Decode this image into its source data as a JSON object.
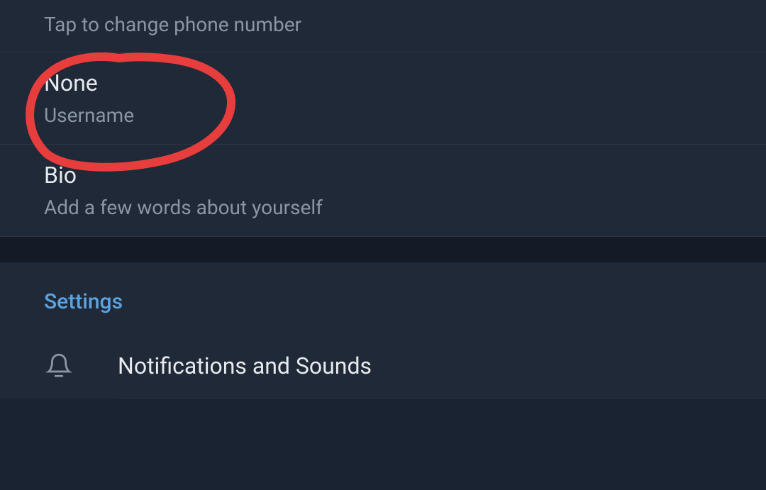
{
  "account": {
    "phone_hint": "Tap to change phone number",
    "username_value": "None",
    "username_label": "Username",
    "bio_title": "Bio",
    "bio_hint": "Add a few words about yourself"
  },
  "settings": {
    "header": "Settings",
    "items": [
      {
        "label": "Notifications and Sounds",
        "icon": "bell-icon"
      }
    ]
  },
  "annotation": {
    "color": "#e83d3d"
  }
}
